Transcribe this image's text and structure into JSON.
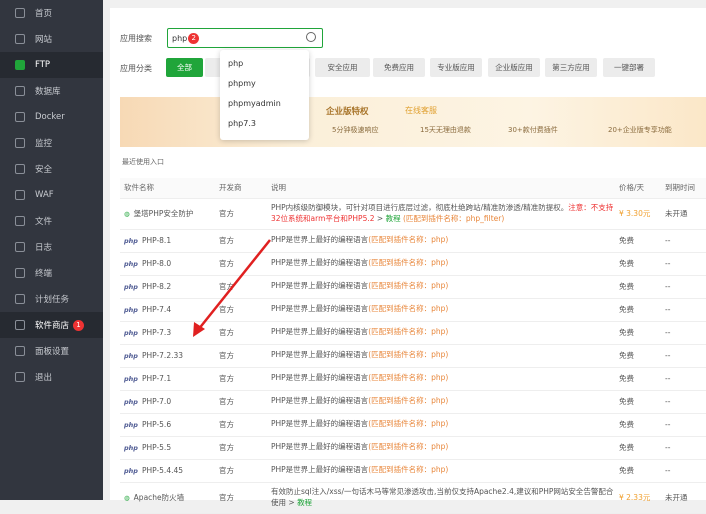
{
  "sidebar": {
    "items": [
      {
        "label": "首页",
        "icon": "home-icon"
      },
      {
        "label": "网站",
        "icon": "globe-icon"
      },
      {
        "label": "FTP",
        "icon": "ftp-icon"
      },
      {
        "label": "数据库",
        "icon": "database-icon"
      },
      {
        "label": "Docker",
        "icon": "docker-icon"
      },
      {
        "label": "监控",
        "icon": "monitor-icon"
      },
      {
        "label": "安全",
        "icon": "shield-icon"
      },
      {
        "label": "WAF",
        "icon": "waf-icon"
      },
      {
        "label": "文件",
        "icon": "folder-icon"
      },
      {
        "label": "日志",
        "icon": "log-icon"
      },
      {
        "label": "终端",
        "icon": "terminal-icon"
      },
      {
        "label": "计划任务",
        "icon": "calendar-icon"
      },
      {
        "label": "软件商店",
        "icon": "grid-icon",
        "badge": "1"
      },
      {
        "label": "面板设置",
        "icon": "gear-icon"
      },
      {
        "label": "退出",
        "icon": "logout-icon"
      }
    ]
  },
  "search": {
    "label": "应用搜索",
    "value": "php",
    "badge": "2"
  },
  "dropdown": [
    "php",
    "phpmy",
    "phpmyadmin",
    "php7.3"
  ],
  "categories": {
    "label": "应用分类",
    "items": [
      "全部",
      "",
      "安全应用",
      "免费应用",
      "专业版应用",
      "企业版应用",
      "第三方应用",
      "一键部署"
    ]
  },
  "banner": {
    "title": "企业版特权",
    "service": "在线客服",
    "features": [
      "5分钟极速响应",
      "15天无理由退款",
      "30+款付费插件",
      "20+企业版专享功能"
    ]
  },
  "recent": "最近使用入口",
  "table": {
    "headers": [
      "软件名称",
      "开发商",
      "说明",
      "价格/天",
      "到期时间"
    ],
    "rows": [
      {
        "name": "堡塔PHP安全防护",
        "dev": "官方",
        "desc": "PHP内核级防御模块，可针对项目进行底层过滤，彻底杜绝跨站/精准防渗透/精准防提权。",
        "warn": "注意：不支持32位系统和arm平台和PHP5.2",
        "tutorial_prefix": " > ",
        "tutorial": "教程",
        "match": "(匹配到插件名称：php_filter)",
        "price": "¥ 3.30元",
        "expire": "未开通"
      },
      {
        "name": "PHP-8.1",
        "dev": "官方",
        "desc": "PHP是世界上最好的编程语言",
        "match": "(匹配到插件名称：php)",
        "price": "免费",
        "expire": "--"
      },
      {
        "name": "PHP-8.0",
        "dev": "官方",
        "desc": "PHP是世界上最好的编程语言",
        "match": "(匹配到插件名称：php)",
        "price": "免费",
        "expire": "--"
      },
      {
        "name": "PHP-8.2",
        "dev": "官方",
        "desc": "PHP是世界上最好的编程语言",
        "match": "(匹配到插件名称：php)",
        "price": "免费",
        "expire": "--"
      },
      {
        "name": "PHP-7.4",
        "dev": "官方",
        "desc": "PHP是世界上最好的编程语言",
        "match": "(匹配到插件名称：php)",
        "price": "免费",
        "expire": "--"
      },
      {
        "name": "PHP-7.3",
        "dev": "官方",
        "desc": "PHP是世界上最好的编程语言",
        "match": "(匹配到插件名称：php)",
        "price": "免费",
        "expire": "--"
      },
      {
        "name": "PHP-7.2.33",
        "dev": "官方",
        "desc": "PHP是世界上最好的编程语言",
        "match": "(匹配到插件名称：php)",
        "price": "免费",
        "expire": "--"
      },
      {
        "name": "PHP-7.1",
        "dev": "官方",
        "desc": "PHP是世界上最好的编程语言",
        "match": "(匹配到插件名称：php)",
        "price": "免费",
        "expire": "--"
      },
      {
        "name": "PHP-7.0",
        "dev": "官方",
        "desc": "PHP是世界上最好的编程语言",
        "match": "(匹配到插件名称：php)",
        "price": "免费",
        "expire": "--"
      },
      {
        "name": "PHP-5.6",
        "dev": "官方",
        "desc": "PHP是世界上最好的编程语言",
        "match": "(匹配到插件名称：php)",
        "price": "免费",
        "expire": "--"
      },
      {
        "name": "PHP-5.5",
        "dev": "官方",
        "desc": "PHP是世界上最好的编程语言",
        "match": "(匹配到插件名称：php)",
        "price": "免费",
        "expire": "--"
      },
      {
        "name": "PHP-5.4.45",
        "dev": "官方",
        "desc": "PHP是世界上最好的编程语言",
        "match": "(匹配到插件名称：php)",
        "price": "免费",
        "expire": "--"
      },
      {
        "name": "Apache防火墙",
        "dev": "官方",
        "desc": "有效防止sql注入/xss/一句话木马等常见渗透攻击,当前仅支持Apache2.4,建议和PHP网站安全告警配合使用 > ",
        "tutorial": "教程",
        "price": "¥ 2.33元",
        "expire": "未开通"
      }
    ]
  },
  "colors": {
    "accent": "#20a53a",
    "sidebar": "#32363f",
    "warn": "#ee3333",
    "match": "#e8863a",
    "arrow": "#e02020"
  }
}
